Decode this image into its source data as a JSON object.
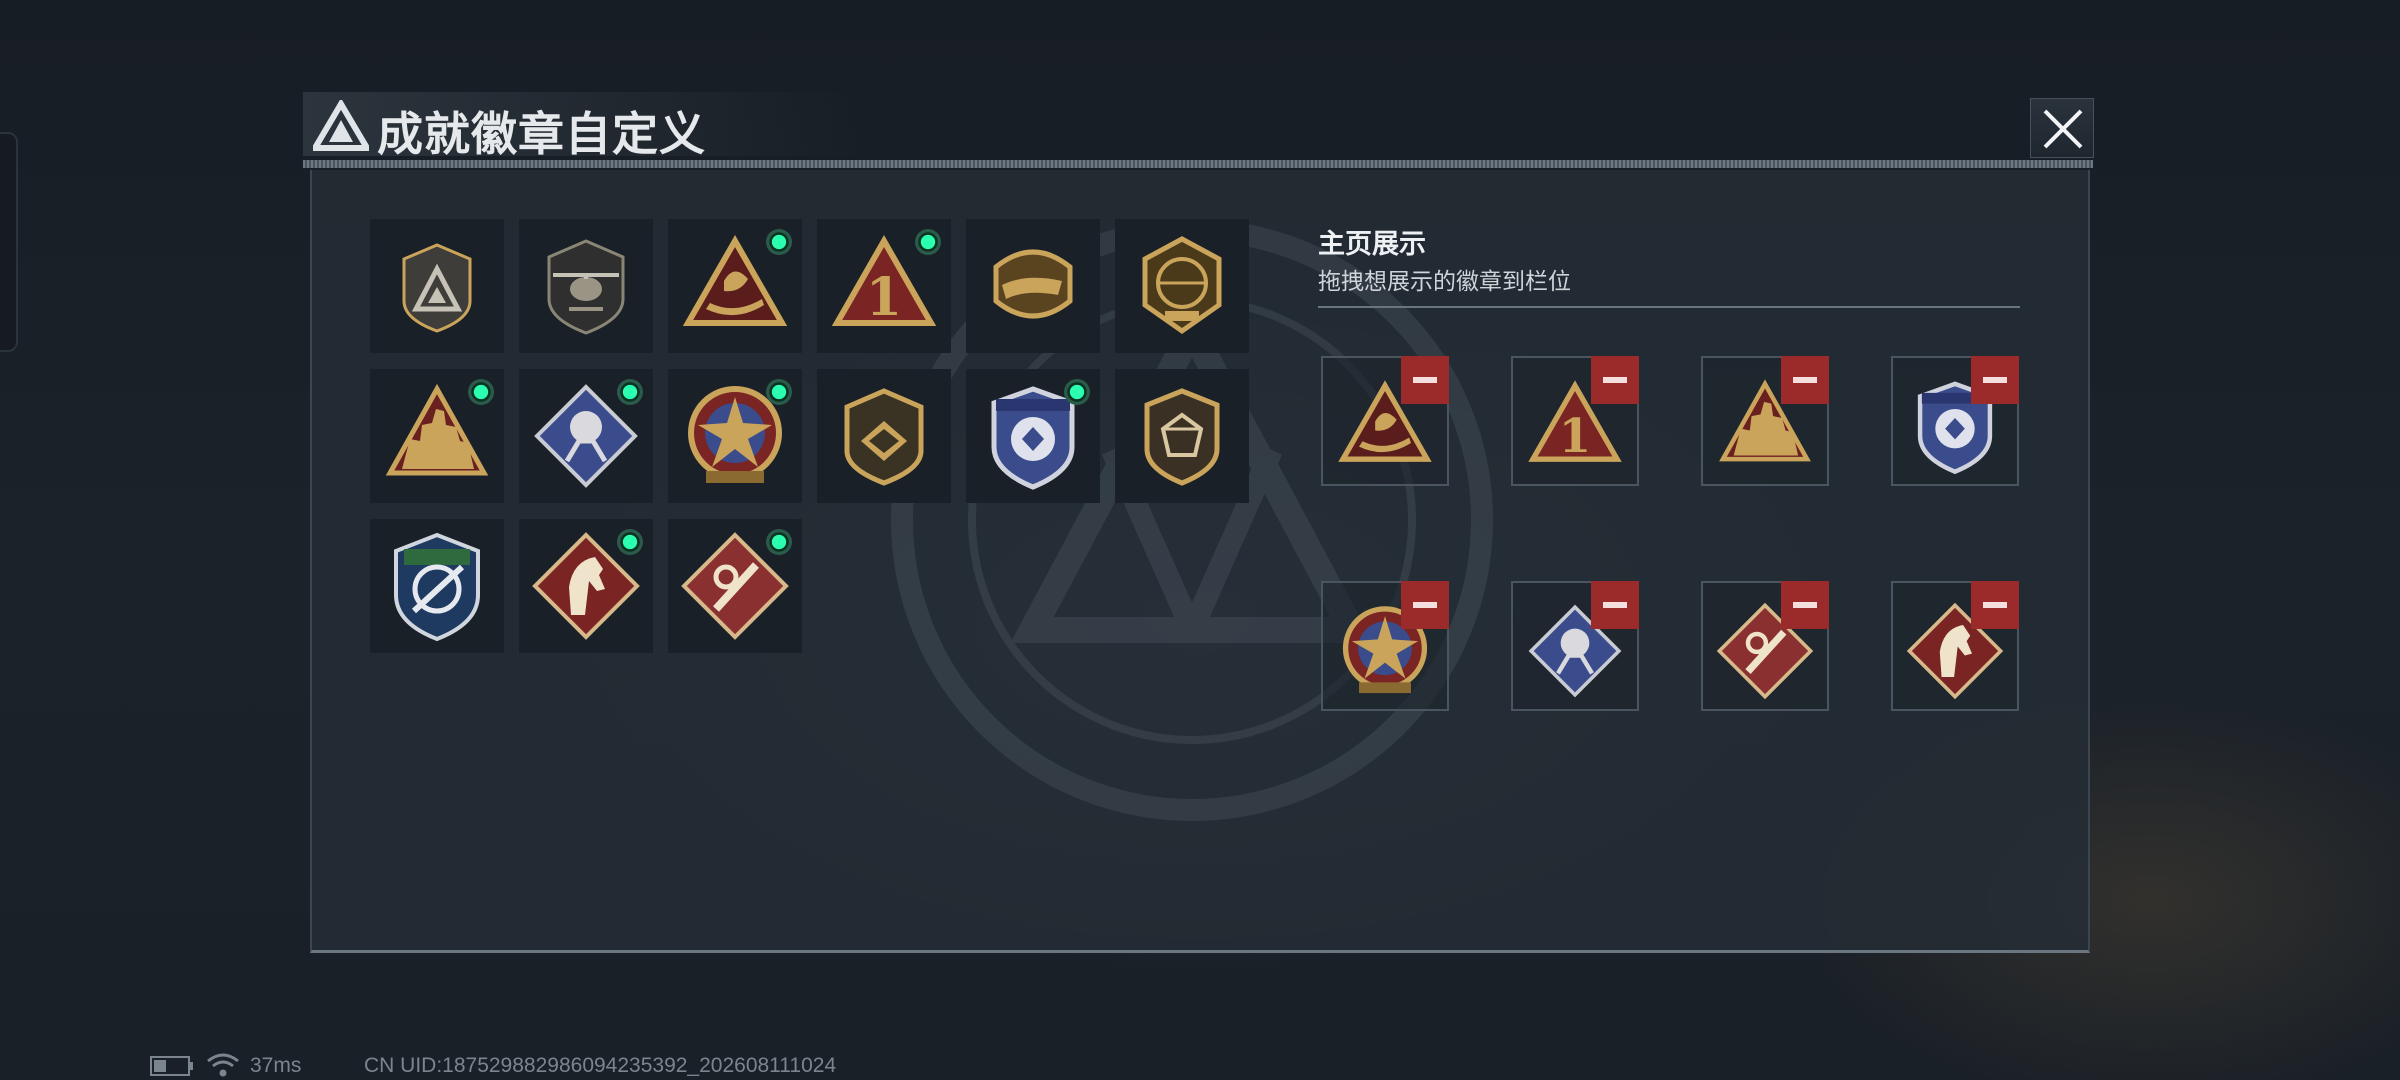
{
  "window": {
    "title": "成就徽章自定义"
  },
  "collection": {
    "badges": [
      {
        "name": "delta-shield-badge",
        "style": "shield-gray",
        "equipped": false
      },
      {
        "name": "helicopter-badge",
        "style": "shield-heli",
        "equipped": false
      },
      {
        "name": "dolphin-triangle-badge",
        "style": "triangle-gold",
        "equipped": true
      },
      {
        "name": "number-one-badge",
        "style": "triangle-red-one",
        "equipped": true
      },
      {
        "name": "crocodile-badge",
        "style": "medal-gold",
        "equipped": false
      },
      {
        "name": "delta-force-2026-badge",
        "style": "globe-gold",
        "equipped": false
      },
      {
        "name": "soldiers-triangle-badge",
        "style": "triangle-soldiers",
        "equipped": true
      },
      {
        "name": "rose-diamond-badge",
        "style": "diamond-blue",
        "equipped": true
      },
      {
        "name": "star-medal-badge",
        "style": "star-round",
        "equipped": true
      },
      {
        "name": "gold-shield-badge",
        "style": "shield-gold",
        "equipped": false
      },
      {
        "name": "blue-police-badge",
        "style": "shield-blue",
        "equipped": true
      },
      {
        "name": "gem-shield-badge",
        "style": "shield-gem",
        "equipped": false
      },
      {
        "name": "green-sword-shield-badge",
        "style": "shield-green",
        "equipped": false
      },
      {
        "name": "horse-diamond-badge",
        "style": "diamond-horse",
        "equipped": true
      },
      {
        "name": "red-tool-diamond-badge",
        "style": "diamond-red",
        "equipped": true
      }
    ]
  },
  "showcase": {
    "title": "主页展示",
    "subtitle": "拖拽想展示的徽章到栏位",
    "slots": [
      {
        "style": "triangle-gold"
      },
      {
        "style": "triangle-red-one"
      },
      {
        "style": "triangle-soldiers"
      },
      {
        "style": "shield-blue"
      },
      {
        "style": "star-round"
      },
      {
        "style": "diamond-blue"
      },
      {
        "style": "diamond-red"
      },
      {
        "style": "diamond-horse"
      }
    ]
  },
  "status": {
    "ping": "37ms",
    "uid": "CN UID:18752988298609423539​2_202608111024"
  },
  "colors": {
    "accent_green": "#2bffb0",
    "remove_red": "#9b2a2a",
    "gold": "#c9a45a"
  }
}
